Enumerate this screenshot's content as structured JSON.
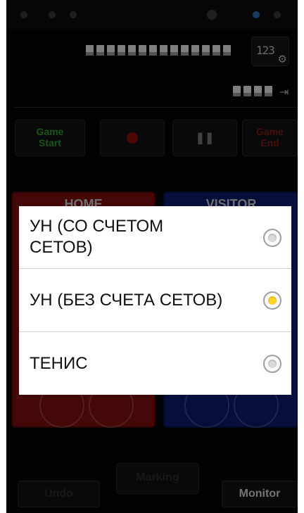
{
  "controls": {
    "game_start": "Game\nStart",
    "game_end": "Game\nEnd"
  },
  "teams": {
    "home": "HOME",
    "visitor": "VISITOR"
  },
  "settings_button": {
    "label": "123"
  },
  "bottom": {
    "undo": "Undo",
    "marking": "Marking",
    "monitor": "Monitor"
  },
  "dialog": {
    "options": [
      {
        "label": "УН (СО СЧЕТОМ\nСЕТОВ)",
        "selected": false
      },
      {
        "label": "УН (БЕЗ СЧЕТА СЕТОВ)",
        "selected": true
      },
      {
        "label": "ТЕНИС",
        "selected": false
      }
    ]
  },
  "colors": {
    "selected_radio": "#ffd42a",
    "home_panel": "#7f1010",
    "visitor_panel": "#0b1a6e",
    "game_start_text": "#2f9a2f",
    "game_end_text": "#7a1b1b"
  },
  "icons": [
    "gear-icon",
    "plug-icon",
    "record-icon",
    "pause-icon",
    "radio-icon"
  ]
}
